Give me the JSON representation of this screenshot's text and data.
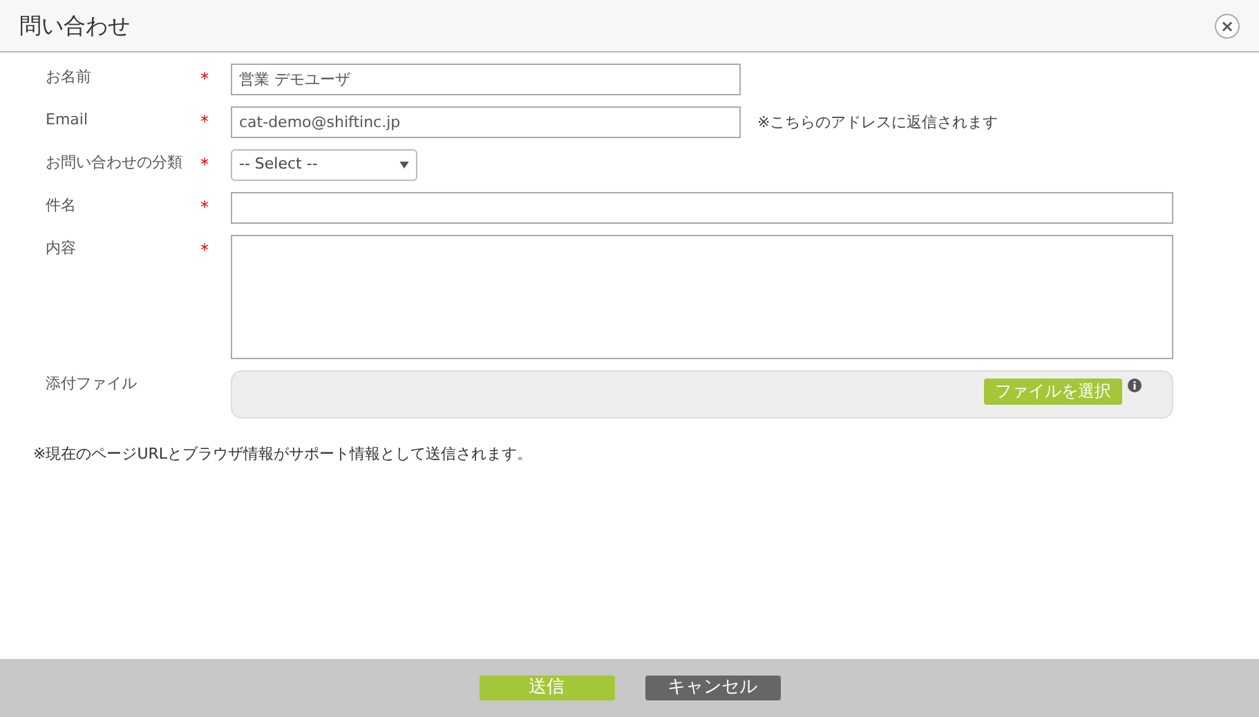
{
  "window": {
    "title": "問い合わせ",
    "close": "×"
  },
  "fields": [
    {
      "kind": "text",
      "label": "お名前",
      "required": "*",
      "value": "営業 デモユーザ"
    },
    {
      "kind": "text",
      "label": "Email",
      "required": "*",
      "value": "cat-demo@shiftinc.jp",
      "note": "※こちらのアドレスに返信されます"
    },
    {
      "kind": "select",
      "label": "お問い合わせの分類",
      "required": "*",
      "value": "-- Select --"
    },
    {
      "kind": "wide",
      "label": "件名",
      "required": "*"
    },
    {
      "kind": "textarea",
      "label": "内容",
      "required": "*"
    },
    {
      "kind": "file",
      "label": "添付ファイル",
      "button": "ファイルを選択"
    }
  ],
  "footnote": "※現在のページURLとブラウザ情報がサポート情報として送信されます。",
  "buttons": [
    {
      "kind": "primary",
      "label": "送信"
    },
    {
      "kind": "secondary",
      "label": "キャンセル"
    }
  ]
}
